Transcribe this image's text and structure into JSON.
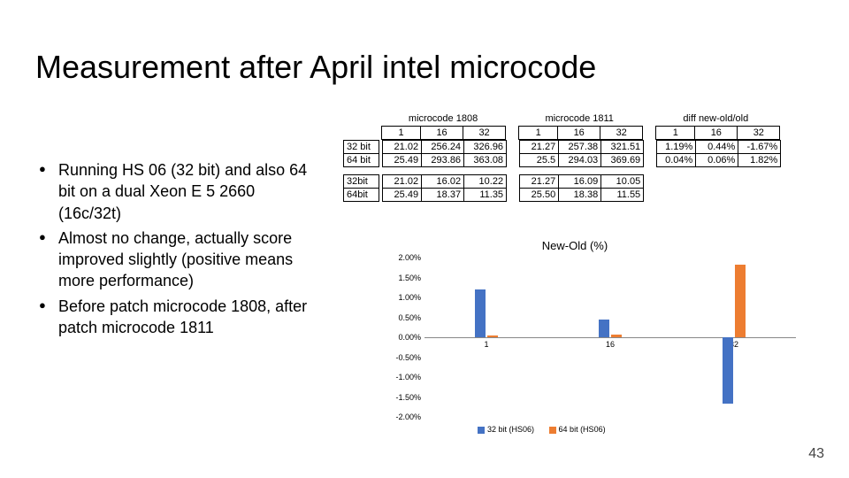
{
  "title": "Measurement after April intel microcode",
  "bullets": [
    "Running HS 06 (32 bit) and also 64 bit on a dual Xeon E 5 2660 (16c/32t)",
    "Almost no change, actually score improved slightly (positive means more performance)",
    "Before patch microcode 1808, after patch microcode 1811"
  ],
  "table": {
    "group_headers": [
      "microcode 1808",
      "microcode 1811",
      "diff new-old/old"
    ],
    "col_headers": [
      "1",
      "16",
      "32"
    ],
    "rows_top": [
      {
        "label": "32 bit",
        "g1": [
          "21.02",
          "256.24",
          "326.96"
        ],
        "g2": [
          "21.27",
          "257.38",
          "321.51"
        ],
        "g3": [
          "1.19%",
          "0.44%",
          "-1.67%"
        ]
      },
      {
        "label": "64 bit",
        "g1": [
          "25.49",
          "293.86",
          "363.08"
        ],
        "g2": [
          "25.5",
          "294.03",
          "369.69"
        ],
        "g3": [
          "0.04%",
          "0.06%",
          "1.82%"
        ]
      }
    ],
    "rows_bot": [
      {
        "label": "32bit",
        "g1": [
          "21.02",
          "16.02",
          "10.22"
        ],
        "g2": [
          "21.27",
          "16.09",
          "10.05"
        ]
      },
      {
        "label": "64bit",
        "g1": [
          "25.49",
          "18.37",
          "11.35"
        ],
        "g2": [
          "25.50",
          "18.38",
          "11.55"
        ]
      }
    ]
  },
  "chart_data": {
    "type": "bar",
    "title": "New-Old (%)",
    "categories": [
      "1",
      "16",
      "32"
    ],
    "series": [
      {
        "name": "32 bit (HS06)",
        "color": "#4472c4",
        "values": [
          1.19,
          0.44,
          -1.67
        ]
      },
      {
        "name": "64 bit (HS06)",
        "color": "#ed7d31",
        "values": [
          0.04,
          0.06,
          1.82
        ]
      }
    ],
    "ylim": [
      -2.0,
      2.0
    ],
    "ystep": 0.5,
    "ylabel": "",
    "xlabel": ""
  },
  "page_number": "43"
}
